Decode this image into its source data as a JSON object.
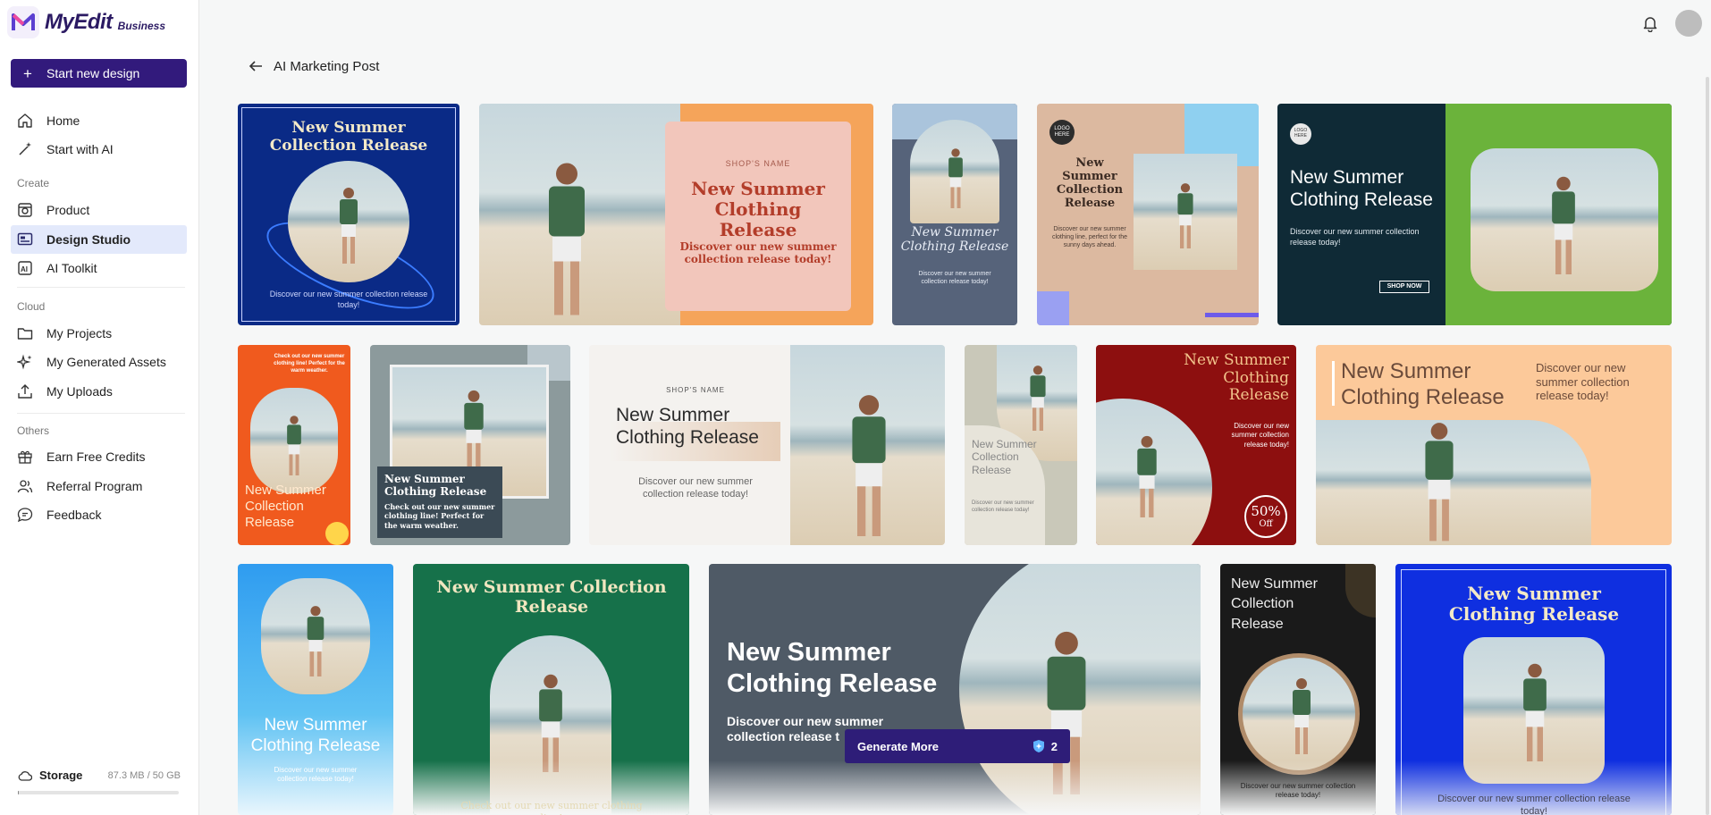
{
  "app": {
    "brand": "MyEdit",
    "brand_sub": "Business"
  },
  "sidebar": {
    "new_design": "Start new design",
    "top": [
      {
        "label": "Home"
      },
      {
        "label": "Start with AI"
      }
    ],
    "create_title": "Create",
    "create": [
      {
        "label": "Product"
      },
      {
        "label": "Design Studio"
      },
      {
        "label": "AI Toolkit"
      }
    ],
    "cloud_title": "Cloud",
    "cloud": [
      {
        "label": "My Projects"
      },
      {
        "label": "My Generated Assets"
      },
      {
        "label": "My Uploads"
      }
    ],
    "others_title": "Others",
    "others": [
      {
        "label": "Earn Free Credits"
      },
      {
        "label": "Referral Program"
      },
      {
        "label": "Feedback"
      }
    ],
    "storage_label": "Storage",
    "storage_value": "87.3 MB / 50 GB",
    "storage_used_fraction": 0.0017
  },
  "page": {
    "title": "AI Marketing Post"
  },
  "cards": {
    "c1": {
      "title": "New Summer Collection Release",
      "body": "Discover our new summer collection release today!"
    },
    "c2": {
      "shop": "SHOP'S NAME",
      "title": "New Summer Clothing Release",
      "body": "Discover our new summer collection release today!"
    },
    "c3": {
      "title": "New Summer Clothing Release",
      "body": "Discover our new summer collection release today!"
    },
    "c4": {
      "logo": "LOGO HERE",
      "title": "New Summer Collection Release",
      "body": "Discover our new summer clothing line, perfect for the sunny days ahead."
    },
    "c5": {
      "logo": "LOGO HERE",
      "title": "New Summer Clothing Release",
      "body": "Discover our new summer collection release today!",
      "cta": "SHOP NOW"
    },
    "c6": {
      "title": "New Summer Collection Release",
      "body": "Check out our new summer clothing line! Perfect for the warm weather."
    },
    "c7": {
      "title": "New Summer Clothing Release",
      "body": "Check out our new summer clothing line! Perfect for the warm weather."
    },
    "c8": {
      "shop": "SHOP'S NAME",
      "title": "New Summer Clothing Release",
      "body": "Discover our new summer collection release today!"
    },
    "c9": {
      "title": "New Summer Collection Release",
      "body": "Discover our new summer collection release today!"
    },
    "c10": {
      "title": "New Summer Clothing Release",
      "body": "Discover our new summer collection release today!",
      "badge_pct": "50%",
      "badge_off": "Off"
    },
    "c11": {
      "title": "New Summer Clothing Release",
      "body": "Discover our new summer collection release today!"
    },
    "c12": {
      "title": "New Summer Clothing Release",
      "body": "Discover our new summer collection release today!"
    },
    "c13": {
      "title": "New Summer Collection Release",
      "body": "Check out our new summer clothing line!"
    },
    "c14": {
      "title": "New Summer Clothing Release",
      "body": "Discover our new summer collection release t"
    },
    "c15": {
      "title": "New Summer Collection Release",
      "body": "Discover our new summer collection release today!"
    },
    "c16": {
      "title": "New Summer Clothing Release",
      "body": "Discover our new summer collection release today!"
    }
  },
  "generate": {
    "label": "Generate More",
    "credits": "2"
  },
  "colors": {
    "brand": "#321a7c",
    "active_bg": "#e3e9fb"
  }
}
